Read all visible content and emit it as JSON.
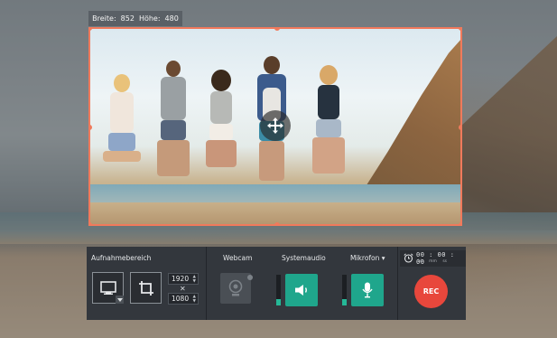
{
  "size_label": {
    "width_label": "Breite:",
    "width_value": "852",
    "height_label": "Höhe:",
    "height_value": "480"
  },
  "panel": {
    "capture_area": {
      "title": "Aufnahmebereich",
      "width_value": "1920",
      "height_value": "1080",
      "times": "✕"
    },
    "webcam": {
      "title": "Webcam"
    },
    "system_audio": {
      "title": "Systemaudio",
      "level": 0.2
    },
    "microphone": {
      "title": "Mikrofon",
      "caret": "▾",
      "level": 0.2
    },
    "timer": {
      "value": "00 : 00 : 00",
      "units": "hh mm ss"
    },
    "rec_label": "REC"
  },
  "colors": {
    "frame": "#f07a5c",
    "accent_green": "#1fa68c",
    "rec_red": "#e8473c",
    "panel_bg": "#33373d"
  },
  "icons": {
    "screen": "monitor-icon",
    "crop": "crop-icon",
    "webcam": "webcam-icon",
    "speaker": "speaker-icon",
    "mic": "microphone-icon",
    "alarm": "alarm-clock-icon",
    "move": "move-arrows-icon"
  }
}
